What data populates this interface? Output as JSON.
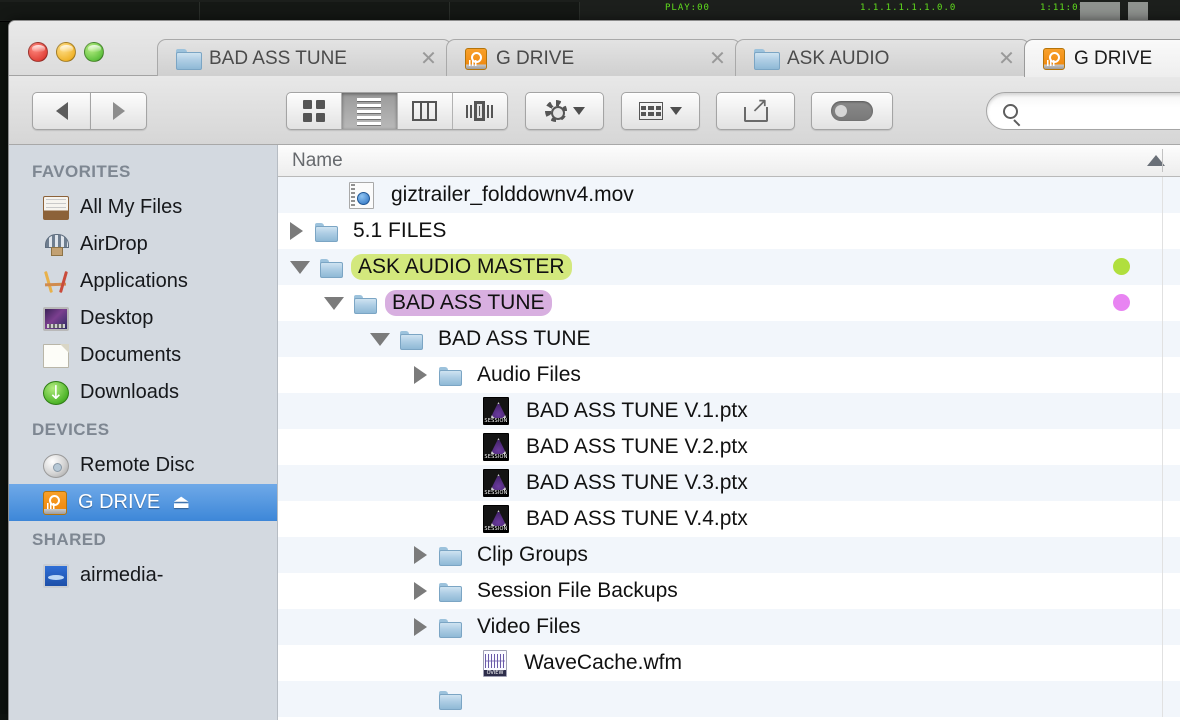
{
  "window": {
    "traffic_lights": [
      "close",
      "minimize",
      "zoom"
    ],
    "tabs": [
      {
        "label": "BAD ASS TUNE",
        "icon": "folder-icon",
        "active": false,
        "close": "✕"
      },
      {
        "label": "G DRIVE",
        "icon": "hard-drive-icon",
        "active": false,
        "close": "✕"
      },
      {
        "label": "ASK AUDIO",
        "icon": "folder-icon",
        "active": false,
        "close": "✕"
      },
      {
        "label": "G DRIVE",
        "icon": "hard-drive-icon",
        "active": true,
        "close": ""
      }
    ]
  },
  "toolbar": {
    "back_label": "Back",
    "forward_label": "Forward",
    "view_modes": [
      {
        "name": "icon-view",
        "active": false
      },
      {
        "name": "list-view",
        "active": true
      },
      {
        "name": "column-view",
        "active": false
      },
      {
        "name": "coverflow-view",
        "active": false
      }
    ],
    "arrange_label": "Arrange",
    "action_label": "Action",
    "share_label": "Share",
    "tags_label": "Tags",
    "search": {
      "value": "",
      "placeholder": ""
    }
  },
  "sidebar": {
    "sections": [
      {
        "header": "FAVORITES",
        "items": [
          {
            "label": "All My Files",
            "icon": "all-my-files-icon",
            "selected": false
          },
          {
            "label": "AirDrop",
            "icon": "airdrop-icon",
            "selected": false
          },
          {
            "label": "Applications",
            "icon": "applications-icon",
            "selected": false
          },
          {
            "label": "Desktop",
            "icon": "desktop-icon",
            "selected": false
          },
          {
            "label": "Documents",
            "icon": "documents-icon",
            "selected": false
          },
          {
            "label": "Downloads",
            "icon": "downloads-icon",
            "selected": false
          }
        ]
      },
      {
        "header": "DEVICES",
        "items": [
          {
            "label": "Remote Disc",
            "icon": "optical-disc-icon",
            "selected": false,
            "eject": ""
          },
          {
            "label": "G DRIVE",
            "icon": "hard-drive-icon",
            "selected": true,
            "eject": "⏏"
          }
        ]
      },
      {
        "header": "SHARED",
        "items": [
          {
            "label": "airmedia-",
            "icon": "shared-computer-icon",
            "selected": false
          }
        ]
      }
    ]
  },
  "filelist": {
    "columns": [
      {
        "label": "Name",
        "sort": "ascending"
      }
    ],
    "sort_arrow": "ascending",
    "rows": [
      {
        "name": "giztrailer_folddownv4.mov",
        "icon": "movie-file-icon",
        "indent": 1,
        "twisty": "none",
        "tag": "",
        "tagdot": ""
      },
      {
        "name": "5.1 FILES",
        "icon": "folder-icon",
        "indent": 0,
        "twisty": "closed",
        "tag": "",
        "tagdot": ""
      },
      {
        "name": "ASK AUDIO MASTER",
        "icon": "folder-icon",
        "indent": 0,
        "twisty": "open",
        "tag": "#d3e87d",
        "tagdot": "#a5dc1e"
      },
      {
        "name": "BAD ASS TUNE",
        "icon": "folder-icon",
        "indent": 1,
        "twisty": "open",
        "tag": "#d8afe0",
        "tagdot": "#e46ff0"
      },
      {
        "name": "BAD ASS TUNE",
        "icon": "folder-icon",
        "indent": 2,
        "twisty": "open",
        "tag": "",
        "tagdot": ""
      },
      {
        "name": "Audio Files",
        "icon": "folder-icon",
        "indent": 3,
        "twisty": "closed",
        "tag": "",
        "tagdot": ""
      },
      {
        "name": "BAD ASS TUNE V.1.ptx",
        "icon": "protools-session-icon",
        "indent": 4,
        "twisty": "none",
        "tag": "",
        "tagdot": ""
      },
      {
        "name": "BAD ASS TUNE V.2.ptx",
        "icon": "protools-session-icon",
        "indent": 4,
        "twisty": "none",
        "tag": "",
        "tagdot": ""
      },
      {
        "name": "BAD ASS TUNE V.3.ptx",
        "icon": "protools-session-icon",
        "indent": 4,
        "twisty": "none",
        "tag": "",
        "tagdot": ""
      },
      {
        "name": "BAD ASS TUNE V.4.ptx",
        "icon": "protools-session-icon",
        "indent": 4,
        "twisty": "none",
        "tag": "",
        "tagdot": ""
      },
      {
        "name": "Clip Groups",
        "icon": "folder-icon",
        "indent": 3,
        "twisty": "closed",
        "tag": "",
        "tagdot": ""
      },
      {
        "name": "Session File Backups",
        "icon": "folder-icon",
        "indent": 3,
        "twisty": "closed",
        "tag": "",
        "tagdot": ""
      },
      {
        "name": "Video Files",
        "icon": "folder-icon",
        "indent": 3,
        "twisty": "closed",
        "tag": "",
        "tagdot": ""
      },
      {
        "name": "WaveCache.wfm",
        "icon": "wavecache-file-icon",
        "indent": 4,
        "twisty": "none",
        "tag": "",
        "tagdot": ""
      },
      {
        "name": "",
        "icon": "folder-icon",
        "indent": 3,
        "twisty": "none",
        "tag": "",
        "tagdot": ""
      }
    ]
  }
}
